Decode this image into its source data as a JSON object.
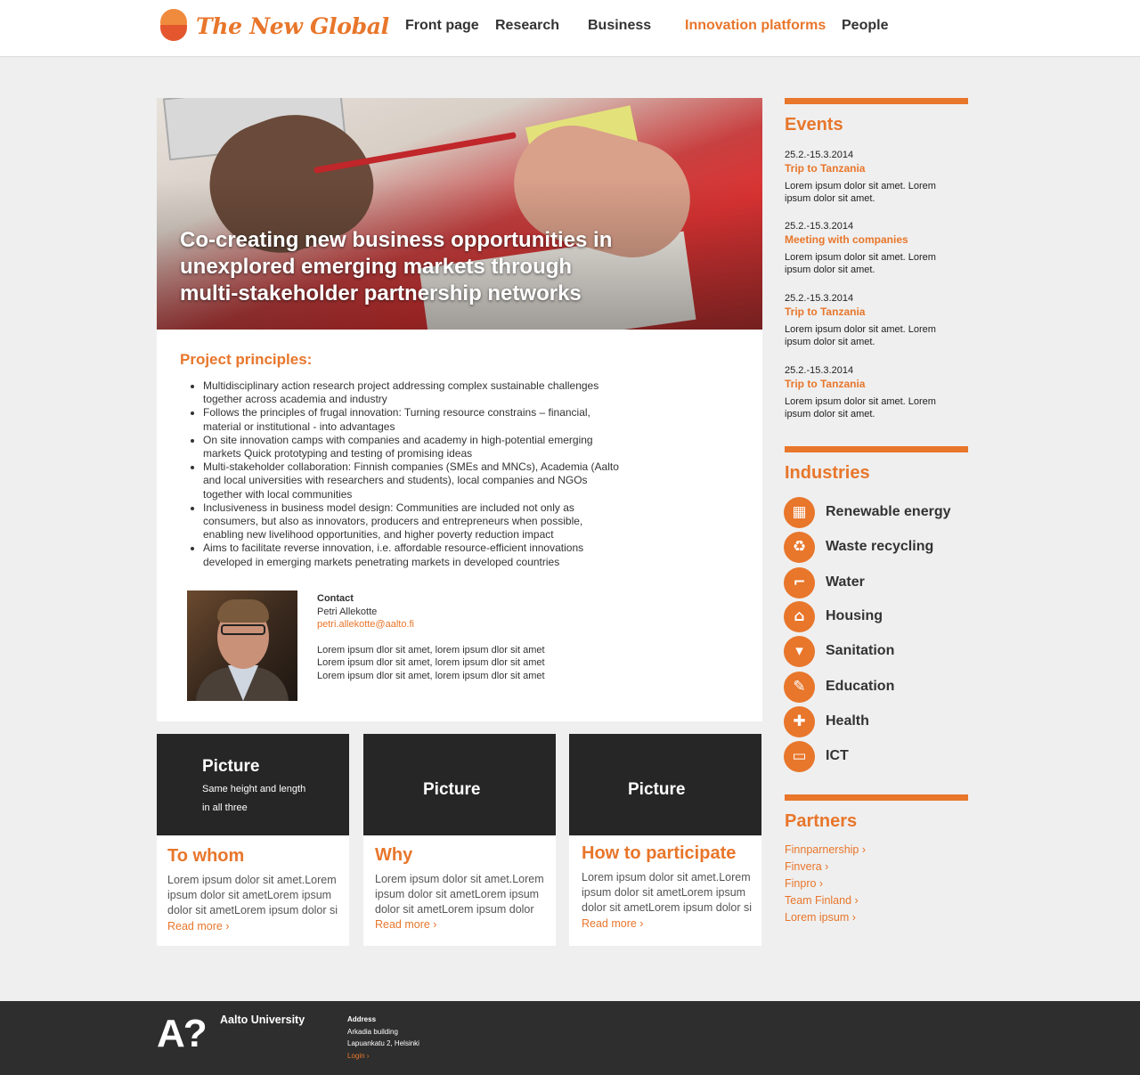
{
  "header": {
    "logo_text": "The New Global",
    "nav": [
      {
        "label": "Front page",
        "active": false
      },
      {
        "label": "Research",
        "active": false
      },
      {
        "label": "Business",
        "active": false
      },
      {
        "label": "Innovation platforms",
        "active": true
      },
      {
        "label": "People",
        "active": false
      }
    ]
  },
  "hero": {
    "title": "Co-creating new business opportunities in unexplored emerging markets through multi-stakeholder partnership networks"
  },
  "principles": {
    "title": "Project principles:",
    "items": [
      "Multidisciplinary action research project addressing complex sustainable challenges together across academia and industry",
      "Follows the principles of frugal innovation: Turning resource constrains – financial, material or institutional - into advantages",
      "On site innovation camps with companies and academy in high-potential emerging markets Quick prototyping and testing of promising ideas",
      "Multi-stakeholder collaboration: Finnish companies (SMEs and MNCs), Academia (Aalto and local universities with researchers and students), local companies and NGOs together with local communities",
      "Inclusiveness in business model design: Communities are included not only as consumers, but also as innovators, producers and entrepreneurs when possible, enabling new livelihood opportunities, and higher poverty reduction impact",
      "Aims to facilitate reverse innovation, i.e. affordable resource-efficient innovations developed in emerging markets penetrating markets in developed countries"
    ]
  },
  "contact": {
    "label": "Contact",
    "name": "Petri Allekotte",
    "email": "petri.allekotte@aalto.fi",
    "lines": [
      "Lorem ipsum dlor sit amet, lorem ipsum dlor sit amet",
      "Lorem ipsum dlor sit amet, lorem ipsum dlor sit amet",
      "Lorem ipsum dlor sit amet, lorem ipsum dlor sit amet"
    ]
  },
  "boxes": [
    {
      "pic_title": "Picture",
      "pic_sub1": "Same height and length",
      "pic_sub2": "in all three",
      "title": "To whom",
      "text": "Lorem ipsum dolor sit amet.Lorem ipsum dolor sit ametLorem ipsum dolor sit ametLorem ipsum dolor si",
      "more": "Read more ›"
    },
    {
      "pic_title": "Picture",
      "title": "Why",
      "text": "Lorem ipsum dolor sit amet.Lorem ipsum dolor sit ametLorem ipsum dolor sit ametLorem ipsum dolor",
      "more": "Read more ›"
    },
    {
      "pic_title": "Picture",
      "title": "How to participate",
      "text": "Lorem ipsum dolor sit amet.Lorem ipsum dolor sit ametLorem ipsum dolor sit ametLorem ipsum dolor si",
      "more": "Read more ›"
    }
  ],
  "events": {
    "title": "Events",
    "items": [
      {
        "date": "25.2.-15.3.2014",
        "name": "Trip to Tanzania",
        "text": "Lorem ipsum dolor sit amet. Lorem ipsum dolor sit amet."
      },
      {
        "date": "25.2.-15.3.2014",
        "name": "Meeting with companies",
        "text": "Lorem ipsum dolor sit amet. Lorem ipsum dolor sit amet."
      },
      {
        "date": "25.2.-15.3.2014",
        "name": "Trip to Tanzania",
        "text": "Lorem ipsum dolor sit amet. Lorem ipsum dolor sit amet."
      },
      {
        "date": "25.2.-15.3.2014",
        "name": "Trip to Tanzania",
        "text": "Lorem ipsum dolor sit amet. Lorem ipsum dolor sit amet."
      }
    ]
  },
  "industries": {
    "title": "Industries",
    "items": [
      {
        "label": "Renewable energy",
        "icon": "solar-panel-icon",
        "glyph": "▦"
      },
      {
        "label": "Waste recycling",
        "icon": "recycle-icon",
        "glyph": "♻"
      },
      {
        "label": "Water",
        "icon": "water-tap-icon",
        "glyph": "⌐"
      },
      {
        "label": "Housing",
        "icon": "house-icon",
        "glyph": "⌂"
      },
      {
        "label": "Sanitation",
        "icon": "toilet-icon",
        "glyph": "▾"
      },
      {
        "label": "Education",
        "icon": "pencil-icon",
        "glyph": "✎"
      },
      {
        "label": "Health",
        "icon": "medical-cross-icon",
        "glyph": "✚"
      },
      {
        "label": "ICT",
        "icon": "monitor-icon",
        "glyph": "▭"
      }
    ]
  },
  "partners": {
    "title": "Partners",
    "items": [
      "Finnparnership ›",
      "Finvera ›",
      "Finpro ›",
      "Team Finland ›",
      "Lorem ipsum ›"
    ]
  },
  "footer": {
    "logo": "A?",
    "university": "Aalto University",
    "address_head": "Address",
    "address_line1": "Arkadia building",
    "address_line2": "Lapuankatu 2, Helsinki",
    "login": "Login ›"
  },
  "colors": {
    "accent": "#e8762b",
    "footer": "#2e2e2e",
    "picture_box": "#262626"
  }
}
